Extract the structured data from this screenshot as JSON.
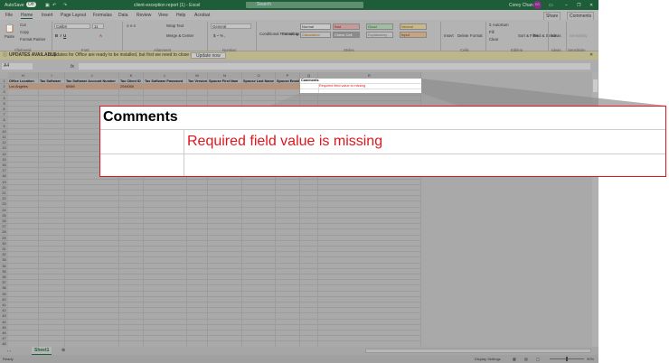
{
  "titlebar": {
    "autosave": "AutoSave",
    "autosave_state": "Off",
    "doc_title": "client-exception report (1) - Excel",
    "search": "Search",
    "user": "Corey Chan",
    "avatar": "CC"
  },
  "menu": [
    "File",
    "Home",
    "Insert",
    "Page Layout",
    "Formulas",
    "Data",
    "Review",
    "View",
    "Help",
    "Acrobat"
  ],
  "share": "Share",
  "comments_btn": "Comments",
  "ribbon": {
    "paste": "Paste",
    "cut": "Cut",
    "copy": "Copy",
    "format_painter": "Format Painter",
    "font": "Calibri",
    "font_size": "11",
    "wrap": "Wrap Text",
    "merge": "Merge & Center",
    "number_format": "General",
    "conditional": "Conditional Formatting",
    "format_table": "Format as Table",
    "styles": [
      {
        "label": "Normal",
        "bg": "#c9c9c9",
        "color": "#333"
      },
      {
        "label": "Bad",
        "bg": "#c79a9a",
        "color": "#8a1c1c"
      },
      {
        "label": "Good",
        "bg": "#a3bda3",
        "color": "#2d5a2d"
      },
      {
        "label": "Neutral",
        "bg": "#c9b98a",
        "color": "#7a5a10"
      },
      {
        "label": "Calculation",
        "bg": "#bdbdbd",
        "color": "#a35a10"
      },
      {
        "label": "Check Cell",
        "bg": "#8c8c8c",
        "color": "#eee"
      },
      {
        "label": "Explanatory ...",
        "bg": "#bdbdbd",
        "color": "#666"
      },
      {
        "label": "Input",
        "bg": "#c9a280",
        "color": "#444"
      }
    ],
    "insert": "Insert",
    "delete": "Delete",
    "format": "Format",
    "autosum": "AutoSum",
    "fill": "Fill",
    "clear": "Clear",
    "sort": "Sort & Filter",
    "find": "Find & Select",
    "ideas": "Ideas",
    "sensitivity": "Sensitivity",
    "groups": [
      "Clipboard",
      "Font",
      "Alignment",
      "Number",
      "Styles",
      "Cells",
      "Editing",
      "Ideas",
      "Sensitivity"
    ]
  },
  "update_bar": {
    "title": "UPDATES AVAILABLE",
    "message": "Updates for Office are ready to be installed, but first we need to close some apps.",
    "button": "Update now"
  },
  "formula_bar": {
    "name_box": "A4",
    "fx": "fx"
  },
  "columns": [
    "H",
    "I",
    "J",
    "K",
    "L",
    "M",
    "N",
    "O",
    "P",
    "Q",
    "R"
  ],
  "headers": [
    "Office Location",
    "Tax Software",
    "Tax Software Account Number",
    "Tax Client ID",
    "Tax Software Password",
    "Tax Version",
    "Spouse First Nam",
    "Spouse Last Name",
    "Spouse Email",
    "Comments"
  ],
  "row2": [
    "Los Angeles",
    "",
    "600M",
    "2044058"
  ],
  "comment_cell": {
    "header": "Comments",
    "message": "Required field value is missing"
  },
  "row_numbers": [
    1,
    2,
    3,
    4,
    5,
    6,
    7,
    8,
    9,
    10,
    11,
    12,
    13,
    14,
    15,
    16,
    17,
    18,
    19,
    20,
    21,
    22,
    23,
    24,
    25,
    26,
    27,
    28,
    29,
    30,
    31,
    32,
    33,
    34,
    35,
    36,
    37,
    38,
    39,
    40,
    41,
    42,
    43,
    44,
    45,
    46,
    47,
    48,
    49
  ],
  "sheet_tab": "Sheet1",
  "status": {
    "ready": "Ready",
    "display_settings": "Display Settings",
    "zoom": "90%"
  }
}
